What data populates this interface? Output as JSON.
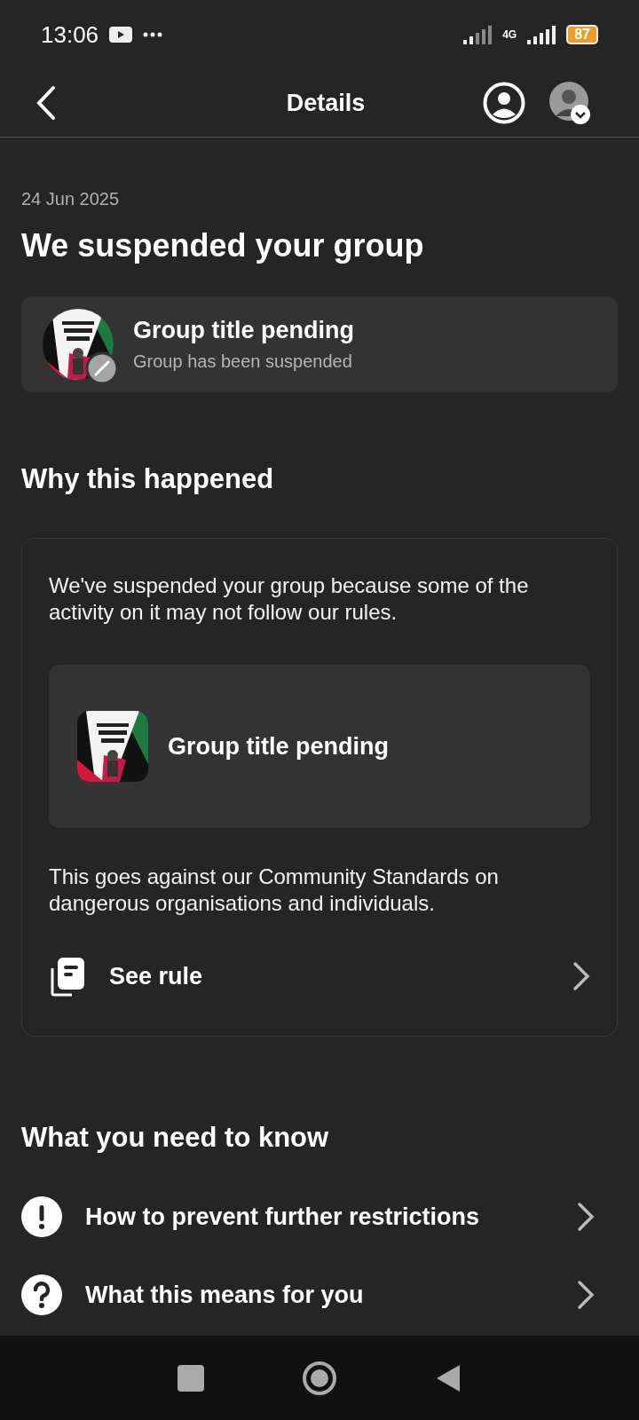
{
  "status_bar": {
    "time": "13:06",
    "network": "4G",
    "battery": "87"
  },
  "header": {
    "title": "Details"
  },
  "date": "24 Jun 2025",
  "title": "We suspended your group",
  "group_card": {
    "name": "Group title pending",
    "status": "Group has been suspended"
  },
  "why": {
    "heading": "Why this happened",
    "intro": "We've suspended your group because some of the activity on it may not follow our rules.",
    "group_name": "Group title pending",
    "explanation": "This goes against our Community Standards on dangerous organisations and individuals.",
    "link": "See rule"
  },
  "know": {
    "heading": "What you need to know",
    "items": [
      {
        "kind": "warning",
        "label": "How to prevent further restrictions"
      },
      {
        "kind": "question",
        "label": "What this means for you"
      }
    ]
  }
}
